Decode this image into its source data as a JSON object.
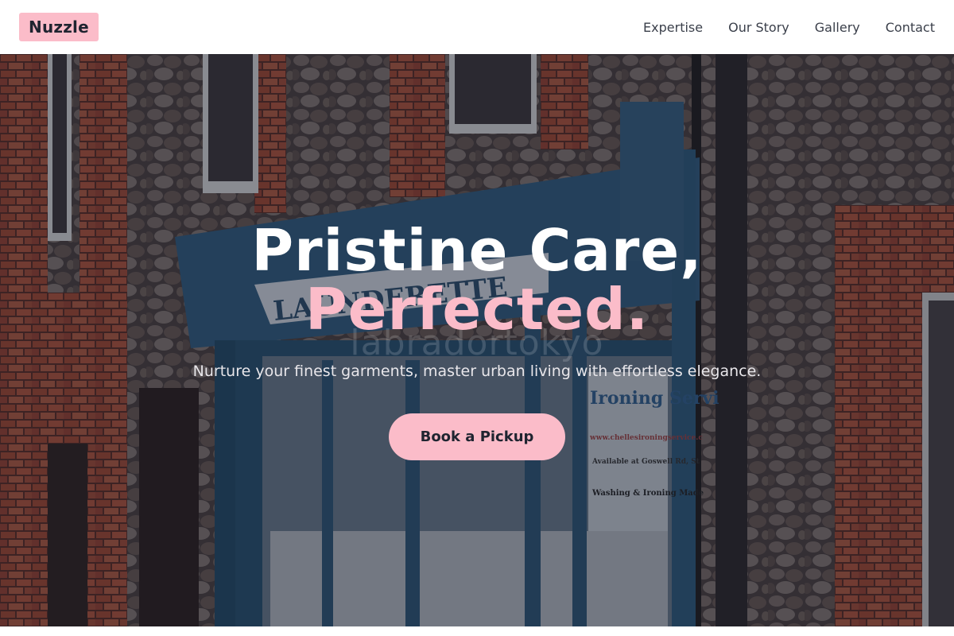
{
  "header": {
    "logo": "Nuzzle",
    "nav": [
      "Expertise",
      "Our Story",
      "Gallery",
      "Contact"
    ]
  },
  "hero": {
    "title_line1": "Pristine Care,",
    "title_line2": "Perfected.",
    "subtitle": "Nurture your finest garments, master urban living with effortless elegance.",
    "cta_label": "Book a Pickup",
    "watermark": "labradortokyo",
    "storefront_sign": "LAUNDERETTE",
    "window_text": [
      "Ironing Servi",
      "www.chellesironingservice.c",
      "Available at Goswell Rd, St",
      "Washing & Ironing Made"
    ]
  },
  "colors": {
    "accent_pink": "#fbbcc9",
    "dark_text": "#1f2430",
    "header_bg": "#ffffff"
  }
}
